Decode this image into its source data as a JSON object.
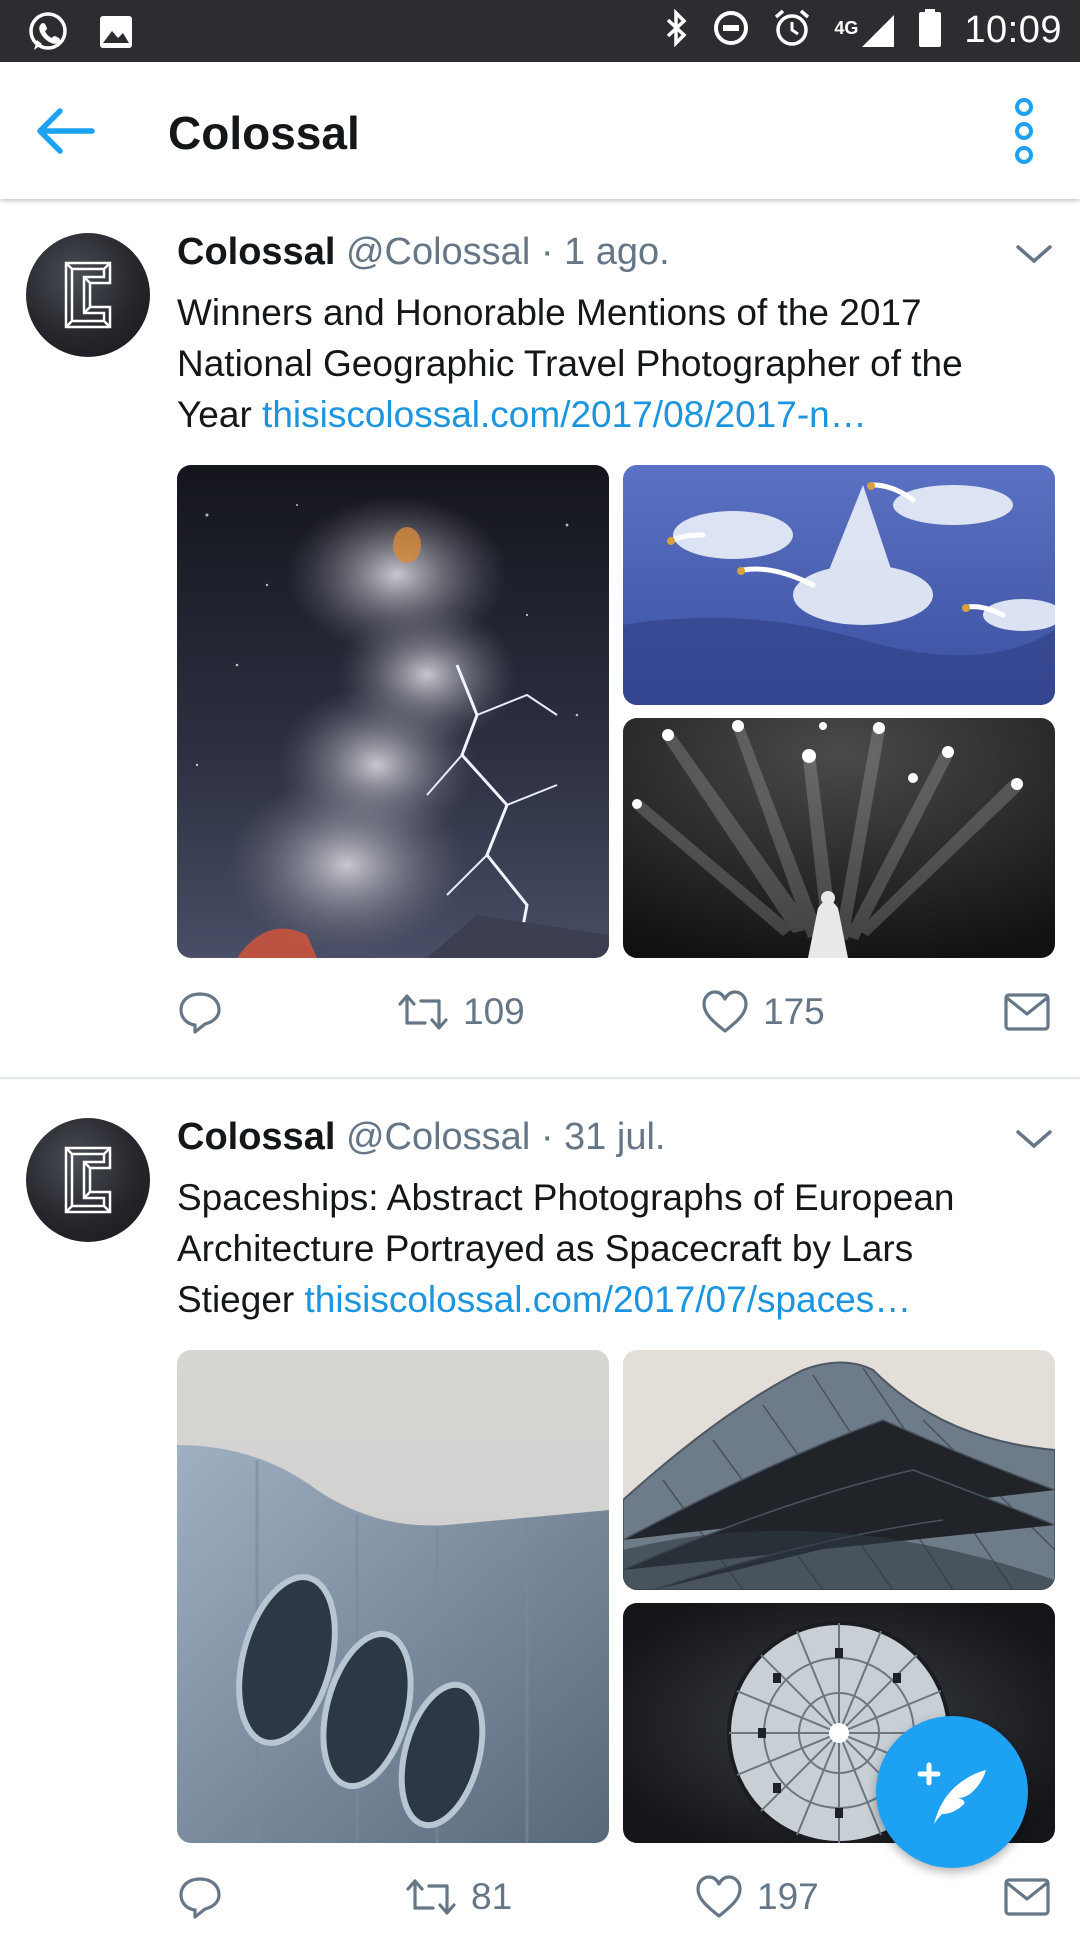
{
  "status_bar": {
    "time": "10:09",
    "network": "4G",
    "left_icons": [
      "whatsapp-icon",
      "image-icon"
    ],
    "right_icons": [
      "bluetooth-icon",
      "do-not-disturb-icon",
      "alarm-icon",
      "signal-icon",
      "battery-icon"
    ]
  },
  "app_bar": {
    "title": "Colossal",
    "back_icon": "arrow-left-icon",
    "menu_icon": "more-vertical-icon",
    "accent": "#1da1f2"
  },
  "tweets": [
    {
      "name": "Colossal",
      "handle": "@Colossal",
      "separator": "·",
      "time": "1 ago.",
      "text": "Winners and Honorable Mentions of the 2017 National Geographic Travel Photographer of the Year ",
      "link": "thisiscolossal.com/2017/08/2017-n…",
      "retweets": "109",
      "likes": "175"
    },
    {
      "name": "Colossal",
      "handle": "@Colossal",
      "separator": "·",
      "time": "31 jul.",
      "text": "Spaceships: Abstract Photographs of European Architecture Portrayed as Spacecraft by Lars Stieger ",
      "link": "thisiscolossal.com/2017/07/spaces…",
      "retweets": "81",
      "likes": "197"
    }
  ],
  "colors": {
    "link": "#1b95e0",
    "secondary_text": "#657786",
    "fab": "#1da1f2"
  }
}
